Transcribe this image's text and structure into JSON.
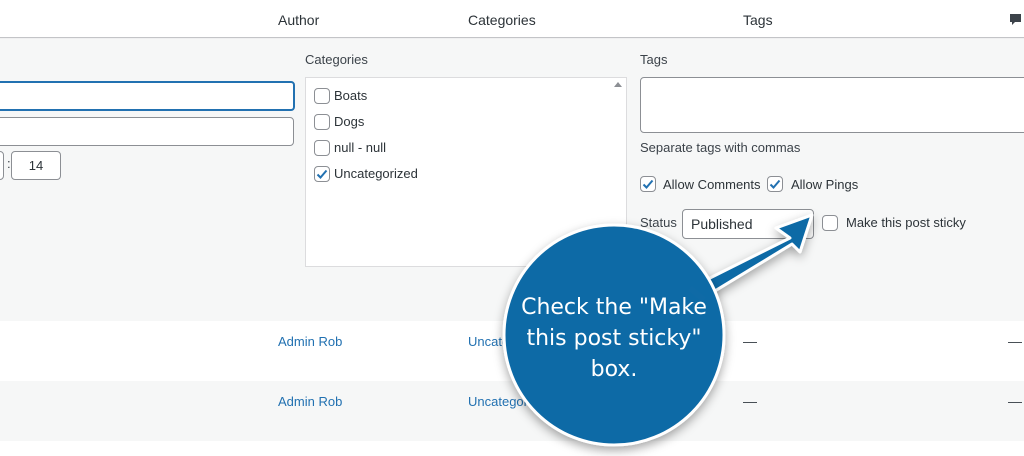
{
  "header": {
    "columns": [
      "Author",
      "Categories",
      "Tags"
    ]
  },
  "quick_edit": {
    "time_minute": "14",
    "time_separator": ":",
    "categories_label": "Categories",
    "categories": [
      {
        "label": "Boats",
        "checked": false
      },
      {
        "label": "Dogs",
        "checked": false
      },
      {
        "label": "null - null",
        "checked": false
      },
      {
        "label": "Uncategorized",
        "checked": true
      }
    ],
    "tags_label": "Tags",
    "tags_hint": "Separate tags with commas",
    "allow_comments_label": "Allow Comments",
    "allow_comments_checked": true,
    "allow_pings_label": "Allow Pings",
    "allow_pings_checked": true,
    "status_label": "Status",
    "status_value": "Published",
    "sticky_label": "Make this post sticky",
    "sticky_checked": false
  },
  "rows": [
    {
      "author": "Admin Rob",
      "category": "Uncategorized",
      "tags": "—",
      "comments": "—"
    },
    {
      "author": "Admin Rob",
      "category": "Uncategorized",
      "tags": "—",
      "comments": "—"
    }
  ],
  "callout": {
    "line1": "Check the \"Make",
    "line2": "this post sticky\"",
    "line3": "box.",
    "color": "#0f6aa6"
  },
  "colors": {
    "link": "#2271b1",
    "focus": "#2271b1",
    "background": "#f0f0f1"
  }
}
